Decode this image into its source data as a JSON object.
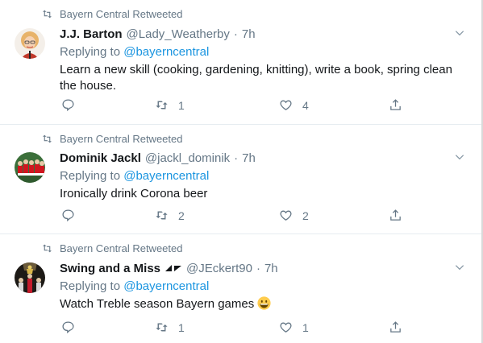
{
  "tweets": [
    {
      "retweeted_by": "Bayern Central Retweeted",
      "name": "J.J. Barton",
      "handle": "@Lady_Weatherby",
      "time": "7h",
      "replying_prefix": "Replying to ",
      "replying_to": "@bayerncentral",
      "text": "Learn a new skill (cooking, gardening, knitting), write a book, spring clean the house.",
      "replies": "",
      "retweets": "1",
      "likes": "4",
      "avatar": "cartoon-woman-avatar"
    },
    {
      "retweeted_by": "Bayern Central Retweeted",
      "name": "Dominik Jackl",
      "handle": "@jackl_dominik",
      "time": "7h",
      "replying_prefix": "Replying to ",
      "replying_to": "@bayerncentral",
      "text": "Ironically drink Corona beer",
      "replies": "",
      "retweets": "2",
      "likes": "2",
      "avatar": "football-team-avatar"
    },
    {
      "retweeted_by": "Bayern Central Retweeted",
      "name": "Swing and a Miss",
      "handle": "@JEckert90",
      "time": "7h",
      "replying_prefix": "Replying to ",
      "replying_to": "@bayerncentral",
      "text": "Watch Treble season Bayern games",
      "replies": "",
      "retweets": "1",
      "likes": "1",
      "avatar": "trophy-celebration-avatar",
      "emoji": "grinning-face-emoji"
    }
  ],
  "colors": {
    "link": "#1b95e0",
    "secondary": "#657786",
    "text": "#14171a",
    "divider": "#e6ecf0"
  }
}
